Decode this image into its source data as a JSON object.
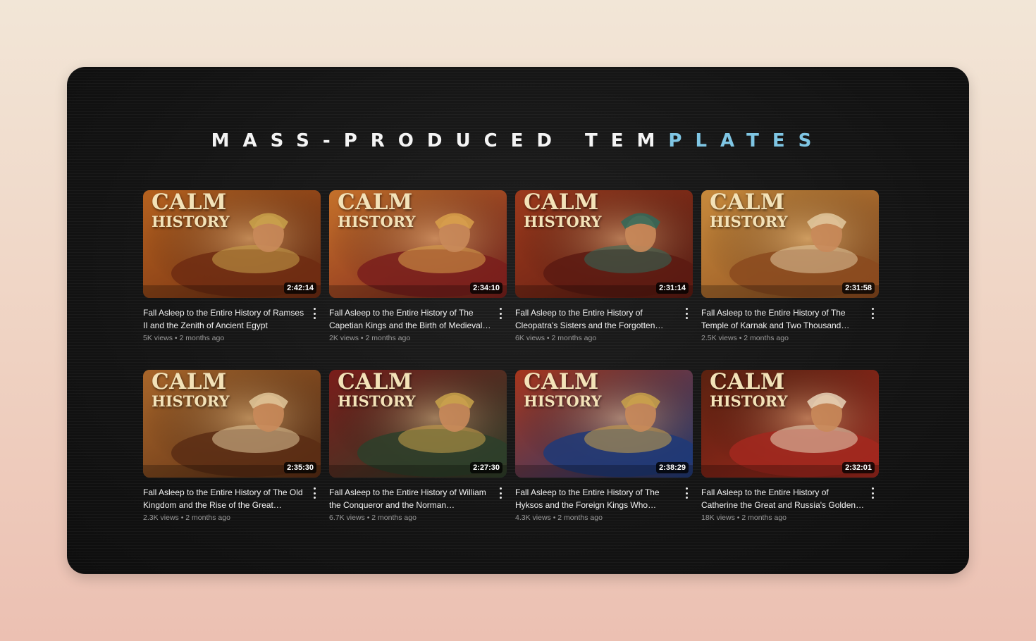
{
  "headline": {
    "text": "MASS-PRODUCED TEMPLATES",
    "white_part": "MASS-PRODUCED TEM",
    "blue_part": "PLATES",
    "white_color": "#f4f4f4",
    "blue_color": "#7fc6e4"
  },
  "brand": {
    "line1": "CALM",
    "line2": "HISTORY"
  },
  "videos": [
    {
      "title": "Fall Asleep to the Entire History of Ramses II and the Zenith of Ancient Egypt",
      "duration": "2:42:14",
      "views": "5K views",
      "age": "2 months ago",
      "palette": [
        "#b5621f",
        "#6e2b12",
        "#c9a24a"
      ]
    },
    {
      "title": "Fall Asleep to the Entire History of The Capetian Kings and the Birth of Medieval…",
      "duration": "2:34:10",
      "views": "2K views",
      "age": "2 months ago",
      "palette": [
        "#c4712a",
        "#7a1f1c",
        "#d8a04a"
      ]
    },
    {
      "title": "Fall Asleep to the Entire History of Cleopatra's Sisters and the Forgotten Royal…",
      "duration": "2:31:14",
      "views": "6K views",
      "age": "2 months ago",
      "palette": [
        "#9c3a1c",
        "#5c1a12",
        "#2f6a5a"
      ]
    },
    {
      "title": "Fall Asleep to the Entire History of The Temple of Karnak and Two Thousand Year…",
      "duration": "2:31:58",
      "views": "2.5K views",
      "age": "2 months ago",
      "palette": [
        "#c78a3c",
        "#8b4a1e",
        "#e2c9a0"
      ]
    },
    {
      "title": "Fall Asleep to the Entire History of The Old Kingdom and the Rise of the Great Pyramids",
      "duration": "2:35:30",
      "views": "2.3K views",
      "age": "2 months ago",
      "palette": [
        "#a8662a",
        "#5a2d14",
        "#e0c79a"
      ]
    },
    {
      "title": "Fall Asleep to the Entire History of William the Conqueror and the Norman…",
      "duration": "2:27:30",
      "views": "6.7K views",
      "age": "2 months ago",
      "palette": [
        "#7a1d1a",
        "#2d3f2a",
        "#c9a34a"
      ]
    },
    {
      "title": "Fall Asleep to the Entire History of The Hyksos and the Foreign Kings Who Ruled…",
      "duration": "2:38:29",
      "views": "4.3K views",
      "age": "2 months ago",
      "palette": [
        "#a6361c",
        "#1f3a78",
        "#c9a24a"
      ]
    },
    {
      "title": "Fall Asleep to the Entire History of Catherine the Great and Russia's Golden Age",
      "duration": "2:32:01",
      "views": "18K views",
      "age": "2 months ago",
      "palette": [
        "#5a2210",
        "#a3281e",
        "#e8d4b8"
      ]
    }
  ]
}
